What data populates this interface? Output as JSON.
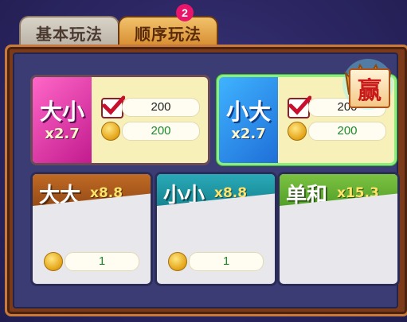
{
  "tabs": [
    {
      "label": "基本玩法"
    },
    {
      "label": "顺序玩法",
      "badge": "2"
    }
  ],
  "panels_top": [
    {
      "name": "大小",
      "multiplier": "x2.7",
      "bet_value": "200",
      "coin_value": "200",
      "selected": false
    },
    {
      "name": "小大",
      "multiplier": "x2.7",
      "bet_value": "200",
      "coin_value": "200",
      "selected": true
    }
  ],
  "panels_bottom": [
    {
      "name": "大大",
      "multiplier": "x8.8",
      "coin_value": "1"
    },
    {
      "name": "小小",
      "multiplier": "x8.8",
      "coin_value": "1"
    },
    {
      "name": "单和",
      "multiplier": "x15.3"
    }
  ],
  "win_badge": "赢",
  "colors": {
    "accent_pink": "#e8156b",
    "selected_border": "#8af07a",
    "coin_text": "#1b8a2a"
  }
}
